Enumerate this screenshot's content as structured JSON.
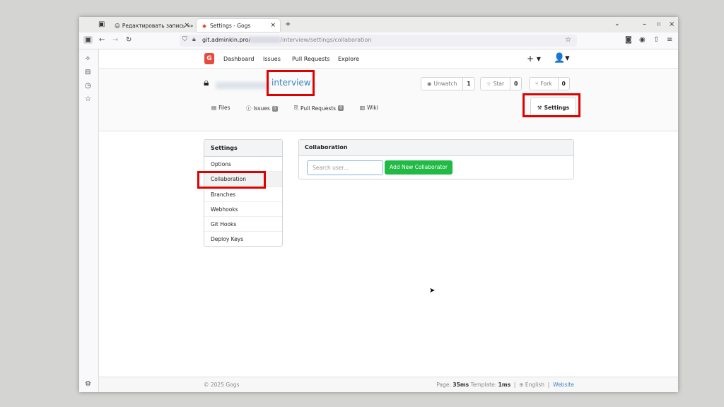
{
  "browser": {
    "tabs": [
      {
        "title": "Редактировать запись «»",
        "close": "×"
      },
      {
        "title": "Settings - Gogs",
        "close": "×"
      }
    ],
    "new_tab": "+",
    "window_controls": {
      "minimize": "–",
      "maximize": "▫",
      "close": "×"
    },
    "url_host": "git.adminkin.pro/",
    "url_path": "/interview/settings/collaboration"
  },
  "topnav": {
    "items": [
      "Dashboard",
      "Issues",
      "Pull Requests",
      "Explore"
    ],
    "plus": "+ ▾",
    "user": "👤▾"
  },
  "repo": {
    "name": "interview",
    "watch": {
      "label": "Unwatch",
      "count": "1"
    },
    "star": {
      "label": "Star",
      "count": "0"
    },
    "fork": {
      "label": "Fork",
      "count": "0"
    },
    "tabs": {
      "files": "Files",
      "issues": "Issues",
      "issues_count": "0",
      "pulls": "Pull Requests",
      "pulls_count": "0",
      "wiki": "Wiki",
      "settings": "Settings"
    }
  },
  "settings_menu": {
    "title": "Settings",
    "items": [
      "Options",
      "Collaboration",
      "Branches",
      "Webhooks",
      "Git Hooks",
      "Deploy Keys"
    ],
    "active": "Collaboration"
  },
  "collaboration": {
    "title": "Collaboration",
    "search_placeholder": "Search user...",
    "add_button": "Add New Collaborator"
  },
  "footer": {
    "copyright": "© 2025 Gogs",
    "page_label": "Page:",
    "page_time": "35ms",
    "template_label": "Template:",
    "template_time": "1ms",
    "language": "English",
    "website": "Website"
  },
  "colors": {
    "accent_link": "#4183c4",
    "add_button": "#21ba45",
    "highlight_box": "#e00000",
    "gogs_logo": "#e84a3b"
  }
}
